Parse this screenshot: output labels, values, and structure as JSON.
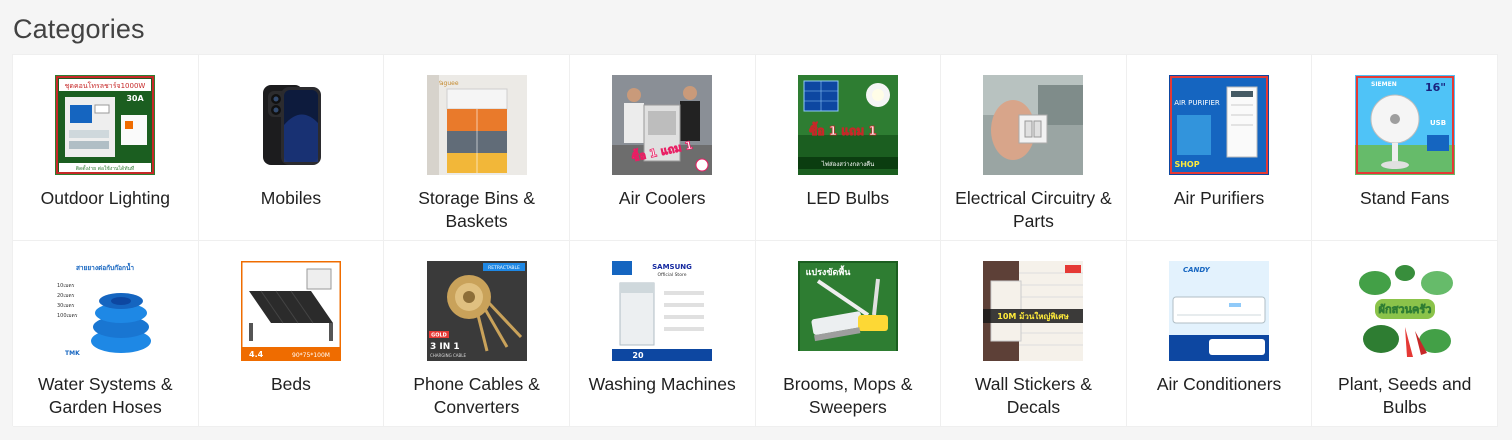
{
  "section": {
    "title": "Categories"
  },
  "categories": [
    {
      "label": "Outdoor Lighting",
      "icon": "solar-power-kit-image",
      "image_text": [
        "ชุดคอนโทรลชาร์จ1000W",
        "30A",
        "ติดตั้งง่าย ต่อใช้งานได้ทันที"
      ]
    },
    {
      "label": "Mobiles",
      "icon": "smartphone-image",
      "image_text": []
    },
    {
      "label": "Storage Bins & Baskets",
      "icon": "storage-cabinet-image",
      "image_text": [
        "Yaguee"
      ]
    },
    {
      "label": "Air Coolers",
      "icon": "air-cooler-image",
      "image_text": [
        "ซื้อ 1 แถม 1"
      ]
    },
    {
      "label": "LED Bulbs",
      "icon": "solar-bulb-image",
      "image_text": [
        "ซื้อ 1 แถม 1",
        "ไฟส่องสว่างกลางคืน"
      ]
    },
    {
      "label": "Electrical Circuitry & Parts",
      "icon": "light-switch-image",
      "image_text": []
    },
    {
      "label": "Air Purifiers",
      "icon": "air-purifier-image",
      "image_text": [
        "AIR PURIFIER",
        "SHOP"
      ]
    },
    {
      "label": "Stand Fans",
      "icon": "solar-fan-image",
      "image_text": [
        "SIEMEN",
        "16\"",
        "USB"
      ]
    },
    {
      "label": "Water Systems & Garden Hoses",
      "icon": "garden-hose-image",
      "image_text": [
        "สายยางต่อกับก๊อกน้ำ",
        "10เมตร",
        "20เมตร",
        "30เมตร",
        "100เมตร",
        "TMK"
      ]
    },
    {
      "label": "Beds",
      "icon": "folding-bed-image",
      "image_text": [
        "4.4",
        "90*75*100M"
      ]
    },
    {
      "label": "Phone Cables & Converters",
      "icon": "charging-cable-image",
      "image_text": [
        "RETRACTABLE",
        "GOLD",
        "3 IN 1",
        "CHARGING CABLE"
      ]
    },
    {
      "label": "Washing Machines",
      "icon": "washing-machine-image",
      "image_text": [
        "SAMSUNG",
        "Official Store",
        "20"
      ]
    },
    {
      "label": "Brooms, Mops & Sweepers",
      "icon": "floor-brush-image",
      "image_text": [
        "แปรงขัดพื้น"
      ]
    },
    {
      "label": "Wall Stickers & Decals",
      "icon": "wall-sticker-image",
      "image_text": [
        "10M ม้วนใหญ่พิเศษ"
      ]
    },
    {
      "label": "Air Conditioners",
      "icon": "air-conditioner-image",
      "image_text": [
        "CANDY"
      ]
    },
    {
      "label": "Plant, Seeds and Bulbs",
      "icon": "vegetable-seeds-image",
      "image_text": [
        "ผักสวนครัว"
      ]
    }
  ]
}
